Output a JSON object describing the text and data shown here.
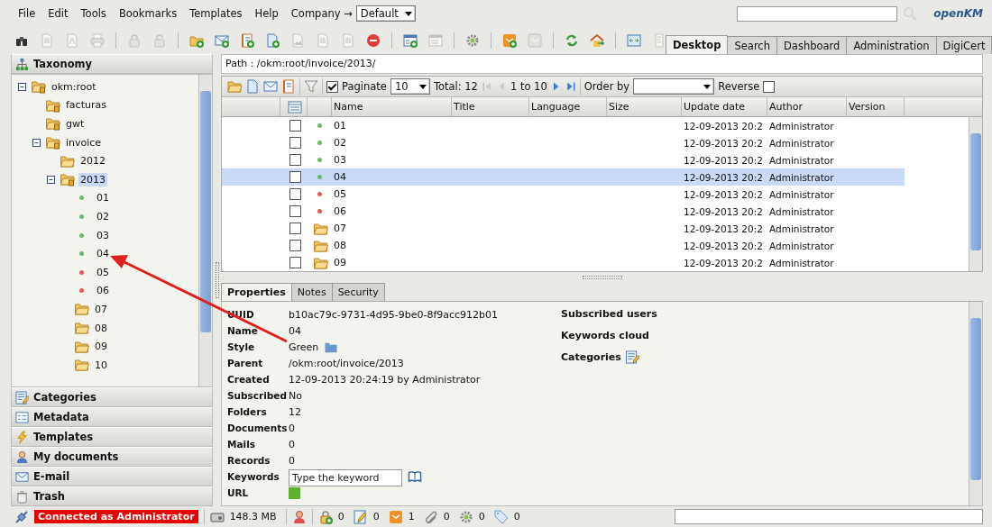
{
  "menu": {
    "items": [
      "File",
      "Edit",
      "Tools",
      "Bookmarks",
      "Templates",
      "Help"
    ],
    "company_label": "Company →",
    "company_value": "Default"
  },
  "logo": "openKM",
  "toolbar": [
    [
      {
        "disabled": false
      },
      {
        "disabled": true
      },
      {
        "disabled": true
      },
      {
        "disabled": true
      }
    ],
    [
      {
        "disabled": true
      },
      {
        "disabled": true
      }
    ],
    [
      {
        "disabled": false
      },
      {
        "disabled": false
      },
      {
        "disabled": false
      },
      {
        "disabled": false
      },
      {
        "disabled": true
      },
      {
        "disabled": true
      },
      {
        "disabled": true
      },
      {
        "disabled": false
      }
    ],
    [
      {
        "disabled": false
      },
      {
        "disabled": true
      }
    ],
    [
      {
        "disabled": false
      }
    ],
    [
      {
        "disabled": false
      },
      {
        "disabled": true
      }
    ],
    [
      {
        "disabled": false
      },
      {
        "disabled": false
      }
    ],
    [
      {
        "disabled": false
      },
      {
        "disabled": true
      }
    ]
  ],
  "main_tabs": [
    {
      "label": "Desktop",
      "selected": true
    },
    {
      "label": "Search",
      "selected": false
    },
    {
      "label": "Dashboard",
      "selected": false
    },
    {
      "label": "Administration",
      "selected": false
    },
    {
      "label": "DigiCert",
      "selected": false
    }
  ],
  "sidebar": {
    "title": "Taxonomy",
    "tree": [
      {
        "label": "okm:root",
        "kind": "badge-folder",
        "selected": false,
        "expanded": true,
        "children": [
          {
            "label": "facturas",
            "kind": "badge-folder",
            "selected": false
          },
          {
            "label": "gwt",
            "kind": "badge-folder",
            "selected": false
          },
          {
            "label": "invoice",
            "kind": "badge-folder",
            "selected": false,
            "expanded": true,
            "children": [
              {
                "label": "2012",
                "kind": "folder",
                "selected": false
              },
              {
                "label": "2013",
                "kind": "badge-folder",
                "selected": true,
                "expanded": true,
                "children": [
                  {
                    "label": "01",
                    "kind": "dot",
                    "color": "#6ab86a",
                    "selected": false
                  },
                  {
                    "label": "02",
                    "kind": "dot",
                    "color": "#6ab86a",
                    "selected": false
                  },
                  {
                    "label": "03",
                    "kind": "dot",
                    "color": "#6ab86a",
                    "selected": false
                  },
                  {
                    "label": "04",
                    "kind": "dot",
                    "color": "#6ab86a",
                    "selected": false
                  },
                  {
                    "label": "05",
                    "kind": "dot",
                    "color": "#e05a5a",
                    "selected": false
                  },
                  {
                    "label": "06",
                    "kind": "dot",
                    "color": "#e05a5a",
                    "selected": false
                  },
                  {
                    "label": "07",
                    "kind": "folder",
                    "selected": false
                  },
                  {
                    "label": "08",
                    "kind": "folder",
                    "selected": false
                  },
                  {
                    "label": "09",
                    "kind": "folder",
                    "selected": false
                  },
                  {
                    "label": "10",
                    "kind": "folder",
                    "selected": false
                  }
                ]
              }
            ]
          }
        ]
      }
    ],
    "stacks": [
      "Categories",
      "Metadata",
      "Templates",
      "My documents",
      "E-mail",
      "Trash"
    ]
  },
  "path": "Path : /okm:root/invoice/2013/",
  "browser": {
    "paginate": {
      "label": "Paginate",
      "checked": true,
      "page_size": "10"
    },
    "total": "Total: 12",
    "range": "1 to 10",
    "order_by": "Order by",
    "reverse": {
      "label": "Reverse",
      "checked": false
    },
    "columns": [
      "Name",
      "Title",
      "Language",
      "Size",
      "Update date",
      "Author",
      "Version"
    ],
    "rows": [
      {
        "name": "01",
        "kind": "dot",
        "color": "#6ab86a",
        "checked": false,
        "selected": false,
        "updated": "12-09-2013 20:2",
        "author": "Administrator"
      },
      {
        "name": "02",
        "kind": "dot",
        "color": "#6ab86a",
        "checked": false,
        "selected": false,
        "updated": "12-09-2013 20:2",
        "author": "Administrator"
      },
      {
        "name": "03",
        "kind": "dot",
        "color": "#6ab86a",
        "checked": false,
        "selected": false,
        "updated": "12-09-2013 20:2",
        "author": "Administrator"
      },
      {
        "name": "04",
        "kind": "dot",
        "color": "#6ab86a",
        "checked": false,
        "selected": true,
        "updated": "12-09-2013 20:2",
        "author": "Administrator"
      },
      {
        "name": "05",
        "kind": "dot",
        "color": "#e05a5a",
        "checked": false,
        "selected": false,
        "updated": "12-09-2013 20:2",
        "author": "Administrator"
      },
      {
        "name": "06",
        "kind": "dot",
        "color": "#e05a5a",
        "checked": false,
        "selected": false,
        "updated": "12-09-2013 20:2",
        "author": "Administrator"
      },
      {
        "name": "07",
        "kind": "folder",
        "checked": false,
        "selected": false,
        "updated": "12-09-2013 20:2",
        "author": "Administrator"
      },
      {
        "name": "08",
        "kind": "folder",
        "checked": false,
        "selected": false,
        "updated": "12-09-2013 20:2",
        "author": "Administrator"
      },
      {
        "name": "09",
        "kind": "folder",
        "checked": false,
        "selected": false,
        "updated": "12-09-2013 20:2",
        "author": "Administrator"
      }
    ]
  },
  "properties": {
    "tabs": [
      {
        "label": "Properties",
        "selected": true
      },
      {
        "label": "Notes",
        "selected": false
      },
      {
        "label": "Security",
        "selected": false
      }
    ],
    "fields": [
      {
        "label": "UUID",
        "kind": "text",
        "value": "b10ac79c-9731-4d95-9be0-8f9acc912b01"
      },
      {
        "label": "Name",
        "kind": "text",
        "value": "04"
      },
      {
        "label": "Style",
        "kind": "style",
        "value": "Green"
      },
      {
        "label": "Parent",
        "kind": "text",
        "value": "/okm:root/invoice/2013"
      },
      {
        "label": "Created",
        "kind": "text",
        "value": "12-09-2013 20:24:19 by Administrator"
      },
      {
        "label": "Subscribed",
        "kind": "text",
        "value": "No"
      },
      {
        "label": "Folders",
        "kind": "text",
        "value": "12"
      },
      {
        "label": "Documents",
        "kind": "text",
        "value": "0"
      },
      {
        "label": "Mails",
        "kind": "text",
        "value": "0"
      },
      {
        "label": "Records",
        "kind": "text",
        "value": "0"
      },
      {
        "label": "Keywords",
        "kind": "keywords",
        "placeholder": "Type the keyword"
      },
      {
        "label": "URL",
        "kind": "url"
      }
    ],
    "side": [
      {
        "label": "Subscribed users",
        "kind": "text"
      },
      {
        "label": "Keywords cloud",
        "kind": "text"
      },
      {
        "label": "Categories",
        "kind": "edit"
      }
    ]
  },
  "status_bar": {
    "connection": "Connected as Administrator",
    "memory": "148.3 MB",
    "counters": [
      "0",
      "0",
      "1",
      "0",
      "0",
      "0"
    ]
  }
}
